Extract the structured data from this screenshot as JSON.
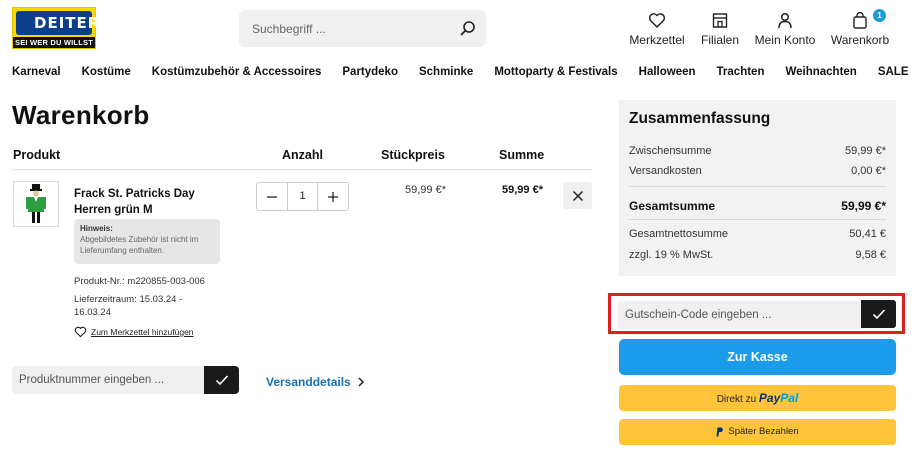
{
  "logo": {
    "brand": "DEITERS",
    "tagline": "SEI WER DU WILLST"
  },
  "search": {
    "placeholder": "Suchbegriff ..."
  },
  "header_actions": [
    {
      "label": "Merkzettel",
      "icon": "heart-icon"
    },
    {
      "label": "Filialen",
      "icon": "store-icon"
    },
    {
      "label": "Mein Konto",
      "icon": "user-icon"
    },
    {
      "label": "Warenkorb",
      "icon": "bag-icon",
      "badge": "1"
    }
  ],
  "nav": [
    "Karneval",
    "Kostüme",
    "Kostümzubehör & Accessoires",
    "Partydeko",
    "Schminke",
    "Mottoparty & Festivals",
    "Halloween",
    "Trachten",
    "Weihnachten",
    "SALE"
  ],
  "cart": {
    "title": "Warenkorb",
    "columns": {
      "product": "Produkt",
      "quantity": "Anzahl",
      "unit_price": "Stückpreis",
      "sum": "Summe"
    },
    "item": {
      "name": "Frack St. Patricks Day Herren grün M",
      "hint_label": "Hinweis:",
      "hint_text": "Abgebildetes Zubehör ist nicht im Lieferumfang enthalten.",
      "product_nr": "Produkt-Nr.: m220855-003-006",
      "delivery": "Lieferzeitraum: 15.03.24 - 16.03.24",
      "wishlist_link": "Zum Merkzettel hinzufügen",
      "quantity": "1",
      "unit_price": "59,99 €*",
      "sum": "59,99 €*"
    },
    "product_nr_input": {
      "placeholder": "Produktnummer eingeben ..."
    },
    "shipping_link": "Versanddetails"
  },
  "summary": {
    "title": "Zusammenfassung",
    "rows": [
      {
        "label": "Zwischensumme",
        "value": "59,99 €*"
      },
      {
        "label": "Versandkosten",
        "value": "0,00 €*"
      }
    ],
    "total": {
      "label": "Gesamtsumme",
      "value": "59,99 €*"
    },
    "net_rows": [
      {
        "label": "Gesamtnettosumme",
        "value": "50,41 €"
      },
      {
        "label": "zzgl. 19 % MwSt.",
        "value": "9,58 €"
      }
    ]
  },
  "coupon": {
    "placeholder": "Gutschein-Code eingeben ..."
  },
  "checkout": {
    "label": "Zur Kasse"
  },
  "paypal": {
    "prefix": "Direkt zu",
    "brand_1": "Pay",
    "brand_2": "Pal"
  },
  "pay_later": {
    "label": "Später Bezahlen"
  },
  "colors": {
    "accent": "#1a9cea",
    "link": "#1a6fb5",
    "paypal": "#ffc439",
    "highlight": "#e02020"
  }
}
